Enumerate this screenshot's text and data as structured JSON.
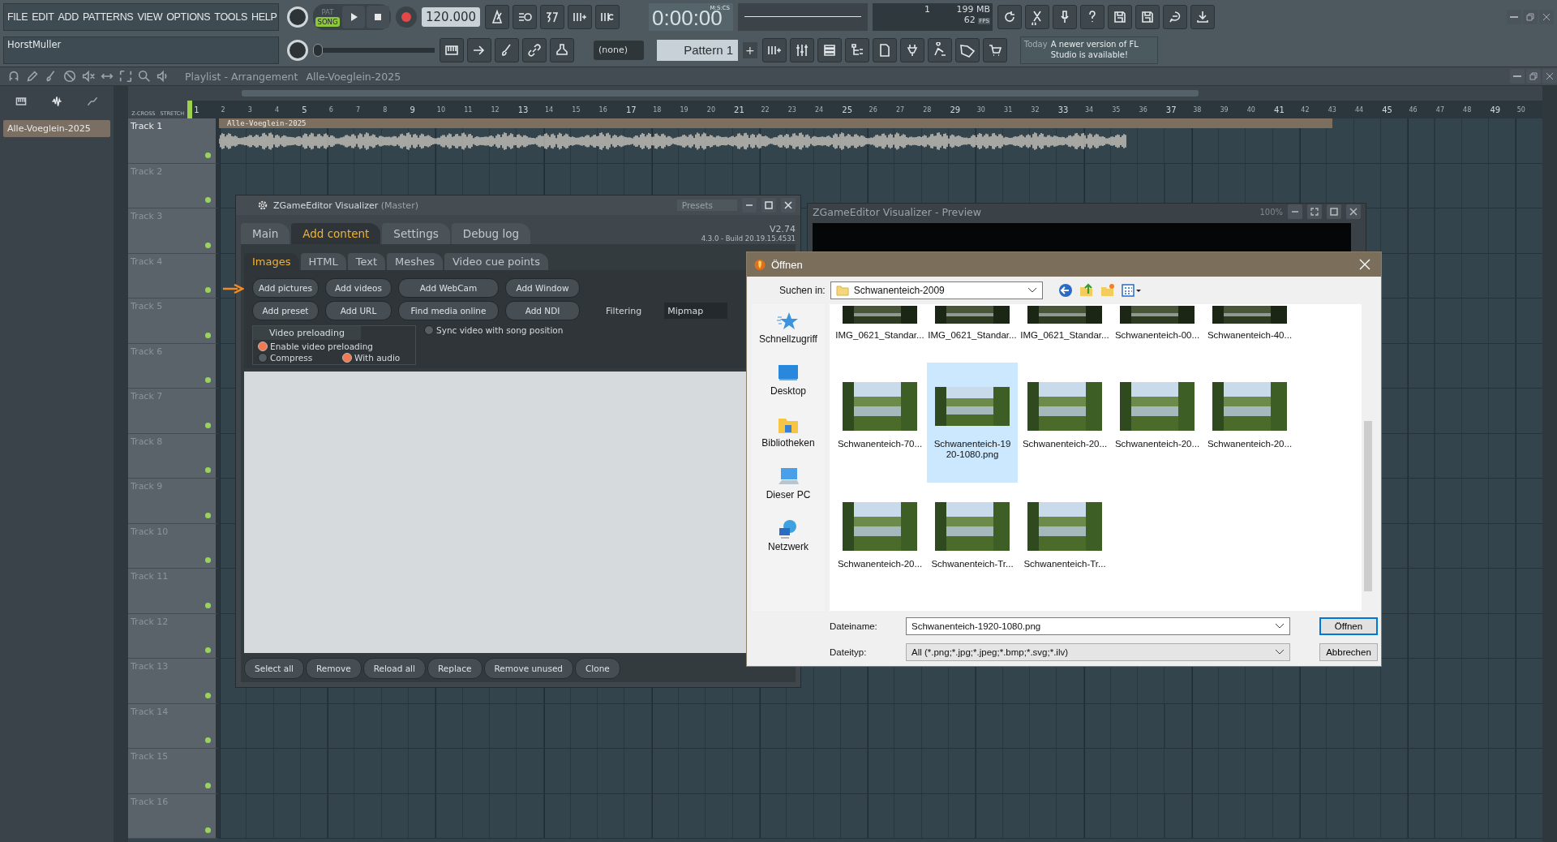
{
  "menu": [
    "FILE",
    "EDIT",
    "ADD",
    "PATTERNS",
    "VIEW",
    "OPTIONS",
    "TOOLS",
    "HELP"
  ],
  "transport": {
    "pat_label": "PAT",
    "song_label": "SONG",
    "song_mode": true,
    "tempo": "120.000",
    "time": "0:00:00",
    "time_format": "M:S:CS"
  },
  "monitor": {
    "voices": "1",
    "memory": "199 MB",
    "fps": "62",
    "fps_label": "FPS"
  },
  "hint_bar": {
    "text": "HorstMuller"
  },
  "master_pitch": {
    "level": 0
  },
  "pattern_selector": {
    "channel": "(none)",
    "pattern": "Pattern 1",
    "add": "+"
  },
  "news": {
    "date": "Today",
    "text": "A newer version of FL Studio is available!"
  },
  "playlist": {
    "title": "Playlist - Arrangement",
    "arrangement": "Alle-Voeglein-2025",
    "zcross": "Z-CROSS",
    "stretch": "STRETCH",
    "ruler": [
      "1",
      "2",
      "3",
      "4",
      "5",
      "6",
      "7",
      "8",
      "9",
      "10",
      "11",
      "12",
      "13",
      "14",
      "15",
      "16",
      "17",
      "18",
      "19",
      "20",
      "21",
      "22",
      "23",
      "24",
      "25",
      "26",
      "27",
      "28",
      "29",
      "30",
      "31",
      "32",
      "33",
      "34",
      "35",
      "36",
      "37",
      "38",
      "39",
      "40",
      "41",
      "42",
      "43",
      "44",
      "45",
      "46",
      "47",
      "48",
      "49",
      "50"
    ],
    "clips_panel": [
      {
        "name": "Alle-Voeglein-2025",
        "selected": true
      }
    ],
    "tracks": [
      {
        "name": "Track 1",
        "clip": "Alle-Voeglein-2025"
      },
      {
        "name": "Track 2"
      },
      {
        "name": "Track 3"
      },
      {
        "name": "Track 4"
      },
      {
        "name": "Track 5"
      },
      {
        "name": "Track 6"
      },
      {
        "name": "Track 7"
      },
      {
        "name": "Track 8"
      },
      {
        "name": "Track 9"
      },
      {
        "name": "Track 10"
      },
      {
        "name": "Track 11"
      },
      {
        "name": "Track 12"
      },
      {
        "name": "Track 13"
      },
      {
        "name": "Track 14"
      },
      {
        "name": "Track 15"
      },
      {
        "name": "Track 16"
      }
    ]
  },
  "plugin": {
    "title": "ZGameEditor Visualizer",
    "subtitle": "(Master)",
    "presets": "Presets",
    "version": "V2.74",
    "build": "4.3.0 - Build 20.19.15.4531",
    "tabs": [
      {
        "label": "Main",
        "selected": false
      },
      {
        "label": "Add content",
        "selected": true
      },
      {
        "label": "Settings",
        "selected": false
      },
      {
        "label": "Debug log",
        "selected": false
      }
    ],
    "subtabs": [
      {
        "label": "Images",
        "selected": true
      },
      {
        "label": "HTML",
        "selected": false
      },
      {
        "label": "Text",
        "selected": false
      },
      {
        "label": "Meshes",
        "selected": false
      },
      {
        "label": "Video cue points",
        "selected": false
      }
    ],
    "button_rows": [
      [
        {
          "label": "Add pictures",
          "pointed": true
        },
        {
          "label": "Add videos",
          "pointed": false
        },
        {
          "label": "Add WebCam",
          "pointed": false
        },
        {
          "label": "Add Window",
          "pointed": false
        }
      ],
      [
        {
          "label": "Add preset",
          "pointed": false
        },
        {
          "label": "Add URL",
          "pointed": false
        },
        {
          "label": "Find media online",
          "pointed": false
        },
        {
          "label": "Add NDI",
          "pointed": false
        }
      ]
    ],
    "filtering_label": "Filtering",
    "filtering_value": "Mipmap",
    "preload_title": "Video preloading",
    "preload_options": [
      {
        "label": "Enable video preloading",
        "checked": true
      },
      {
        "label": "Compress",
        "checked": false
      },
      {
        "label": "With audio",
        "checked": true
      }
    ],
    "sync": {
      "label": "Sync video with song position",
      "checked": false
    },
    "bottom_buttons": [
      "Select all",
      "Remove",
      "Reload all",
      "Replace",
      "Remove unused",
      "Clone"
    ]
  },
  "preview": {
    "title": "ZGameEditor Visualizer - Preview",
    "zoom": "100%"
  },
  "dialog": {
    "title": "Öffnen",
    "look_in_label": "Suchen in:",
    "look_in": "Schwanenteich-2009",
    "places": [
      {
        "label": "Schnellzugriff",
        "kind": "star"
      },
      {
        "label": "Desktop",
        "kind": "desktop"
      },
      {
        "label": "Bibliotheken",
        "kind": "library"
      },
      {
        "label": "Dieser PC",
        "kind": "pc"
      },
      {
        "label": "Netzwerk",
        "kind": "network"
      }
    ],
    "file_rows": [
      [
        {
          "name": "IMG_0621_Standar...",
          "selected": false
        },
        {
          "name": "IMG_0621_Standar...",
          "selected": false
        },
        {
          "name": "IMG_0621_Standar...",
          "selected": false
        },
        {
          "name": "Schwanenteich-00...",
          "selected": false
        },
        {
          "name": "Schwanenteich-40...",
          "selected": false
        }
      ],
      [
        {
          "name": "Schwanenteich-70...",
          "selected": false
        },
        {
          "name": "Schwanenteich-1920-1080.png",
          "selected": true
        },
        {
          "name": "Schwanenteich-20...",
          "selected": false
        },
        {
          "name": "Schwanenteich-20...",
          "selected": false
        },
        {
          "name": "Schwanenteich-20...",
          "selected": false
        }
      ],
      [
        {
          "name": "Schwanenteich-20...",
          "selected": false
        },
        {
          "name": "Schwanenteich-Tr...",
          "selected": false
        },
        {
          "name": "Schwanenteich-Tr...",
          "selected": false
        }
      ]
    ],
    "filename_label": "Dateiname:",
    "filename": "Schwanenteich-1920-1080.png",
    "filetype_label": "Dateityp:",
    "filetype": "All (*.png;*.jpg;*.jpeg;*.bmp;*.svg;*.ilv)",
    "open_button": "Öffnen",
    "cancel_button": "Abbrechen"
  }
}
